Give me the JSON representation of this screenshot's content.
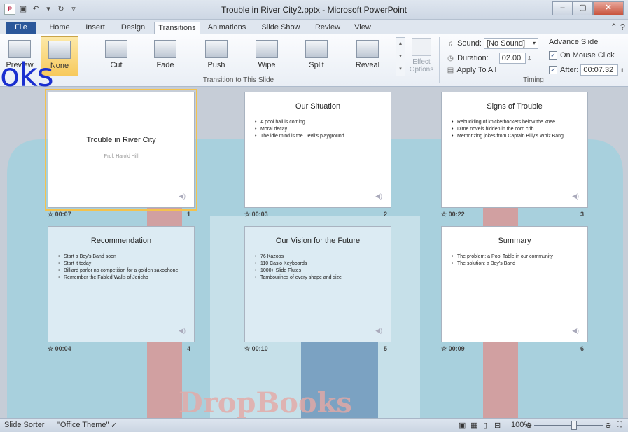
{
  "window": {
    "title": "Trouble in River City2.pptx - Microsoft PowerPoint"
  },
  "tabs": [
    "File",
    "Home",
    "Insert",
    "Design",
    "Transitions",
    "Animations",
    "Slide Show",
    "Review",
    "View"
  ],
  "ribbon": {
    "buttons": [
      "None",
      "Cut",
      "Fade",
      "Push",
      "Wipe",
      "Split",
      "Reveal"
    ],
    "effect_options": "Effect Options",
    "group_label": "Transition to This Slide",
    "preview_label": "Preview",
    "timing": {
      "sound_label": "Sound:",
      "sound_value": "[No Sound]",
      "duration_label": "Duration:",
      "duration_value": "02.00",
      "apply_all": "Apply To All",
      "advance_label": "Advance Slide",
      "on_click": "On Mouse Click",
      "on_click_checked": true,
      "after_label": "After:",
      "after_value": "00:07.32",
      "after_checked": true,
      "group_label": "Timing"
    }
  },
  "overlay_text": "oks",
  "watermark": "DropBooks",
  "slides": [
    {
      "title": "Trouble in River City",
      "subtitle": "Prof. Harold Hill",
      "bullets": [],
      "time": "00:07",
      "num": "1",
      "selected": true,
      "tinted": false
    },
    {
      "title": "Our Situation",
      "subtitle": "",
      "bullets": [
        "A pool hall is coming",
        "Moral decay",
        "The idle mind is the Devil's playground"
      ],
      "time": "00:03",
      "num": "2",
      "selected": false,
      "tinted": false
    },
    {
      "title": "Signs of Trouble",
      "subtitle": "",
      "bullets": [
        "Rebuckling of knickerbockers below the knee",
        "Dime novels hidden in the corn crib",
        "Memorizing jokes from Captain Billy's Whiz Bang."
      ],
      "time": "00:22",
      "num": "3",
      "selected": false,
      "tinted": false
    },
    {
      "title": "Recommendation",
      "subtitle": "",
      "bullets": [
        "Start a Boy's Band soon",
        "Start it today",
        "Billiard parlor no competition for a golden saxophone.",
        "Remember the Fabled Walls of Jericho"
      ],
      "time": "00:04",
      "num": "4",
      "selected": false,
      "tinted": true
    },
    {
      "title": "Our Vision for the Future",
      "subtitle": "",
      "bullets": [
        "76 Kazoos",
        "110 Casio Keyboards",
        "1000+ Slide Flutes",
        "Tambourines of every shape and size"
      ],
      "time": "00:10",
      "num": "5",
      "selected": false,
      "tinted": true
    },
    {
      "title": "Summary",
      "subtitle": "",
      "bullets": [
        "The problem: a Pool Table in our community",
        "The solution: a Boy's Band"
      ],
      "time": "00:09",
      "num": "6",
      "selected": false,
      "tinted": false
    }
  ],
  "status": {
    "view": "Slide Sorter",
    "theme": "\"Office Theme\"",
    "zoom": "100%"
  }
}
